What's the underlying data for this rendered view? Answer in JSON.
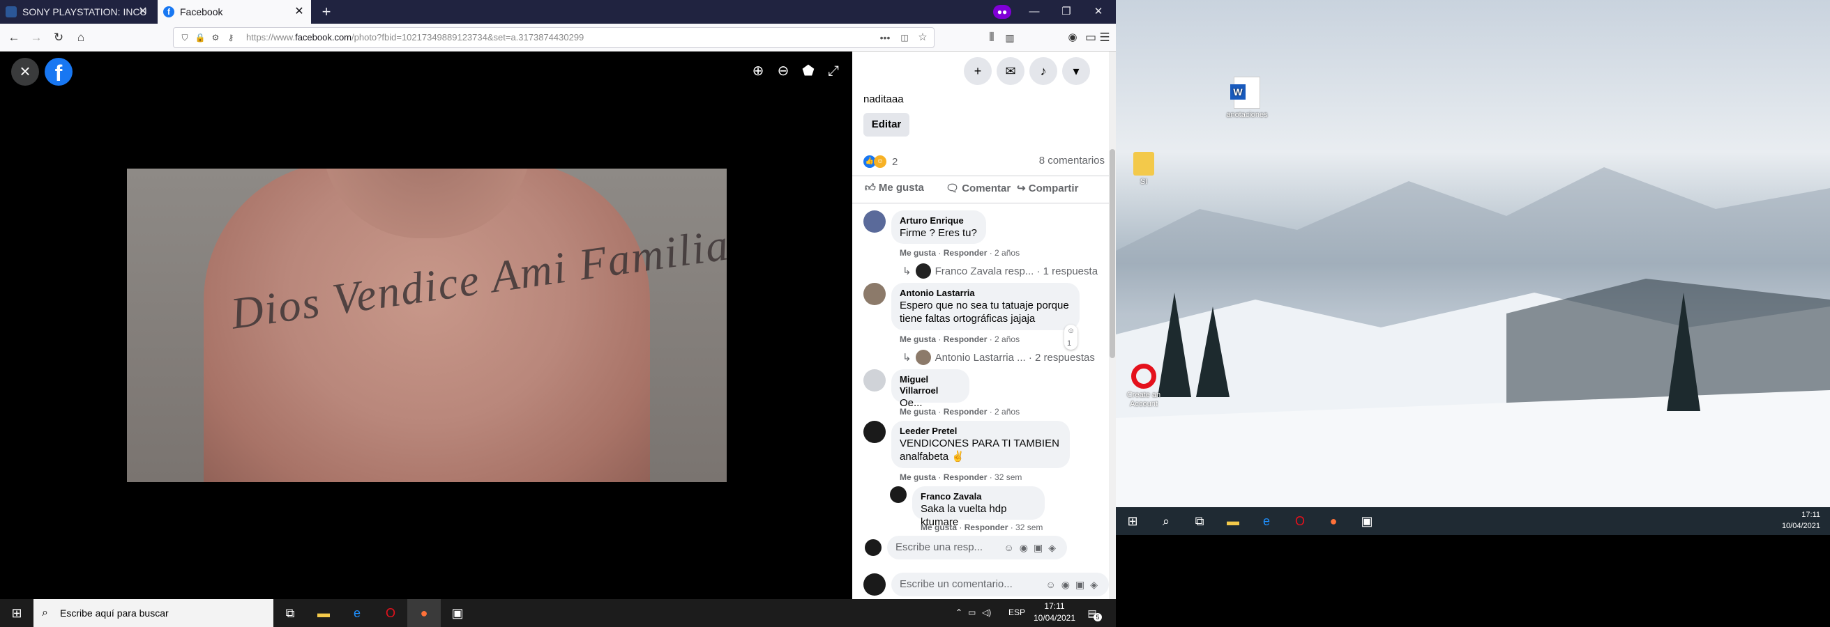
{
  "browser": {
    "tabs": [
      {
        "title": "SONY PLAYSTATION: INCUMPL",
        "active": false
      },
      {
        "title": "Facebook",
        "active": true
      }
    ],
    "url_prefix": "https://www.",
    "url_domain": "facebook.com",
    "url_rest": "/photo?fbid=10217349889123734&set=a.3173874430299"
  },
  "viewer": {
    "tattoo_text": "Dios Vendice Ami Familia"
  },
  "post": {
    "description": "naditaaa",
    "edit_label": "Editar",
    "reaction_count": "2",
    "comment_count": "8 comentarios",
    "actions": {
      "like": "Me gusta",
      "comment": "Comentar",
      "share": "Compartir"
    }
  },
  "comments": [
    {
      "name": "Arturo Enrique",
      "lines": [
        "Firme ? Eres tu?"
      ],
      "like": "Me gusta",
      "reply": "Responder",
      "age": "2 años",
      "replies_preview": "Franco Zavala resp...",
      "replies_count": "· 1 respuesta"
    },
    {
      "name": "Antonio Lastarria",
      "lines": [
        "Espero que no sea tu tatuaje porque",
        "tiene faltas ortográficas jajaja"
      ],
      "like": "Me gusta",
      "reply": "Responder",
      "age": "2 años",
      "reaction": "1",
      "replies_preview": "Antonio Lastarria ...",
      "replies_count": "· 2 respuestas"
    },
    {
      "name": "Miguel Villarroel",
      "lines": [
        "Oe..."
      ],
      "like": "Me gusta",
      "reply": "Responder",
      "age": "2 años"
    },
    {
      "name": "Leeder Pretel",
      "lines": [
        "VENDICONES PARA TI TAMBIEN",
        "analfabeta"
      ],
      "like": "Me gusta",
      "reply": "Responder",
      "age": "32 sem"
    },
    {
      "name": "Franco Zavala",
      "lines": [
        "Saka la vuelta hdp ktumare"
      ],
      "like": "Me gusta",
      "reply": "Responder",
      "age": "32 sem"
    }
  ],
  "reply_placeholder": "Escribe una resp...",
  "comment_placeholder": "Escribe un comentario...",
  "taskbar": {
    "search_placeholder": "Escribe aquí para buscar",
    "lang": "ESP",
    "time": "17:11",
    "date": "10/04/2021",
    "notif_count": "5"
  },
  "desktop": {
    "icons": [
      {
        "label": "anotaciones"
      },
      {
        "label": "SI"
      },
      {
        "label": "Create an Account"
      }
    ],
    "time": "17:11",
    "date": "10/04/2021"
  },
  "colors": {
    "facebook_blue": "#1877f2",
    "firefox_tabbar": "#202340",
    "private_purple": "#8000d7"
  }
}
